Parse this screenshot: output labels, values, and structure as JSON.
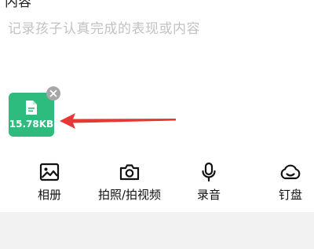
{
  "header": {
    "partial_label": "内容"
  },
  "editor": {
    "placeholder": "记录孩子认真完成的表现或内容"
  },
  "attachment": {
    "size": "15.78KB",
    "icon": "file-icon",
    "color": "#2dbb7e"
  },
  "toolbar": {
    "items": [
      {
        "label": "相册",
        "icon": "image-icon"
      },
      {
        "label": "拍照/拍视频",
        "icon": "camera-icon"
      },
      {
        "label": "录音",
        "icon": "microphone-icon"
      },
      {
        "label": "钉盘",
        "icon": "cloud-icon"
      }
    ]
  },
  "colors": {
    "accent": "#2dbb7e",
    "annotation_arrow": "#e53935",
    "footer": "#f2f2f2"
  }
}
